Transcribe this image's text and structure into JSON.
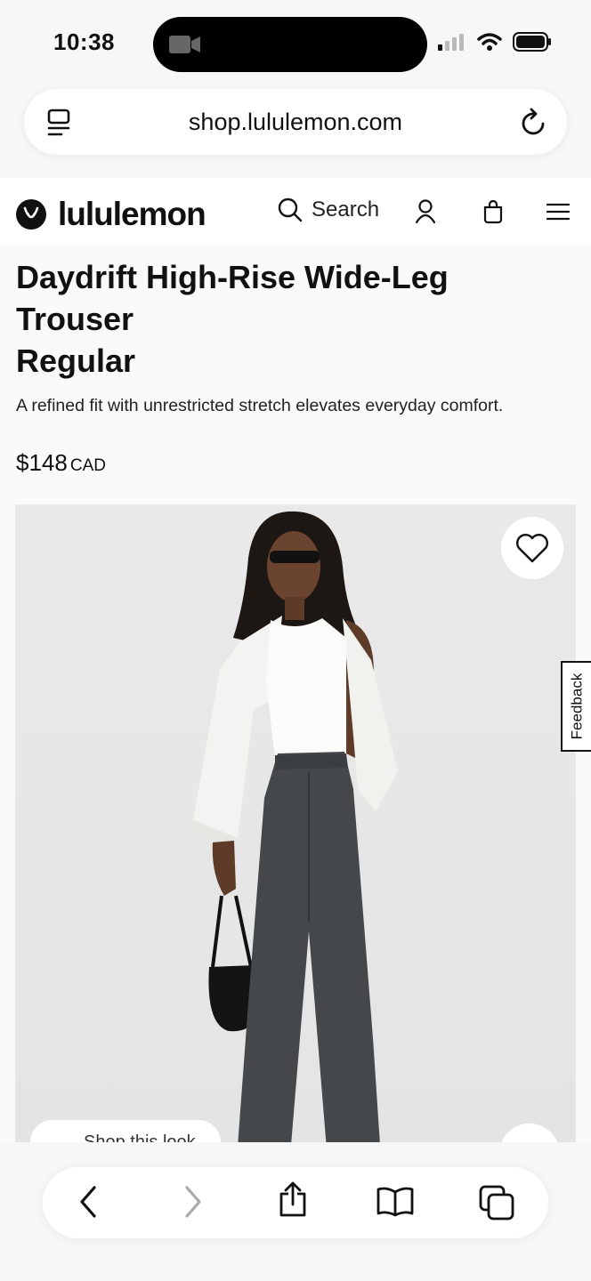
{
  "status_bar": {
    "time": "10:38"
  },
  "browser": {
    "url": "shop.lululemon.com"
  },
  "site_header": {
    "brand": "lululemon",
    "search_label": "Search"
  },
  "product": {
    "title_line1": "Daydrift High-Rise Wide-Leg",
    "title_line2": "Trouser",
    "title_line3": "Regular",
    "description": "A refined fit with unrestricted stretch elevates everyday comfort.",
    "price": "$148",
    "currency": "CAD"
  },
  "image_overlay": {
    "shop_look_label": "Shop this look",
    "feedback_label": "Feedback"
  },
  "icons": {
    "url_left": "reader-icon",
    "reload": "reload-icon",
    "search": "search-icon",
    "account": "account-icon",
    "bag": "bag-icon",
    "menu": "menu-icon",
    "wishlist": "heart-icon"
  }
}
